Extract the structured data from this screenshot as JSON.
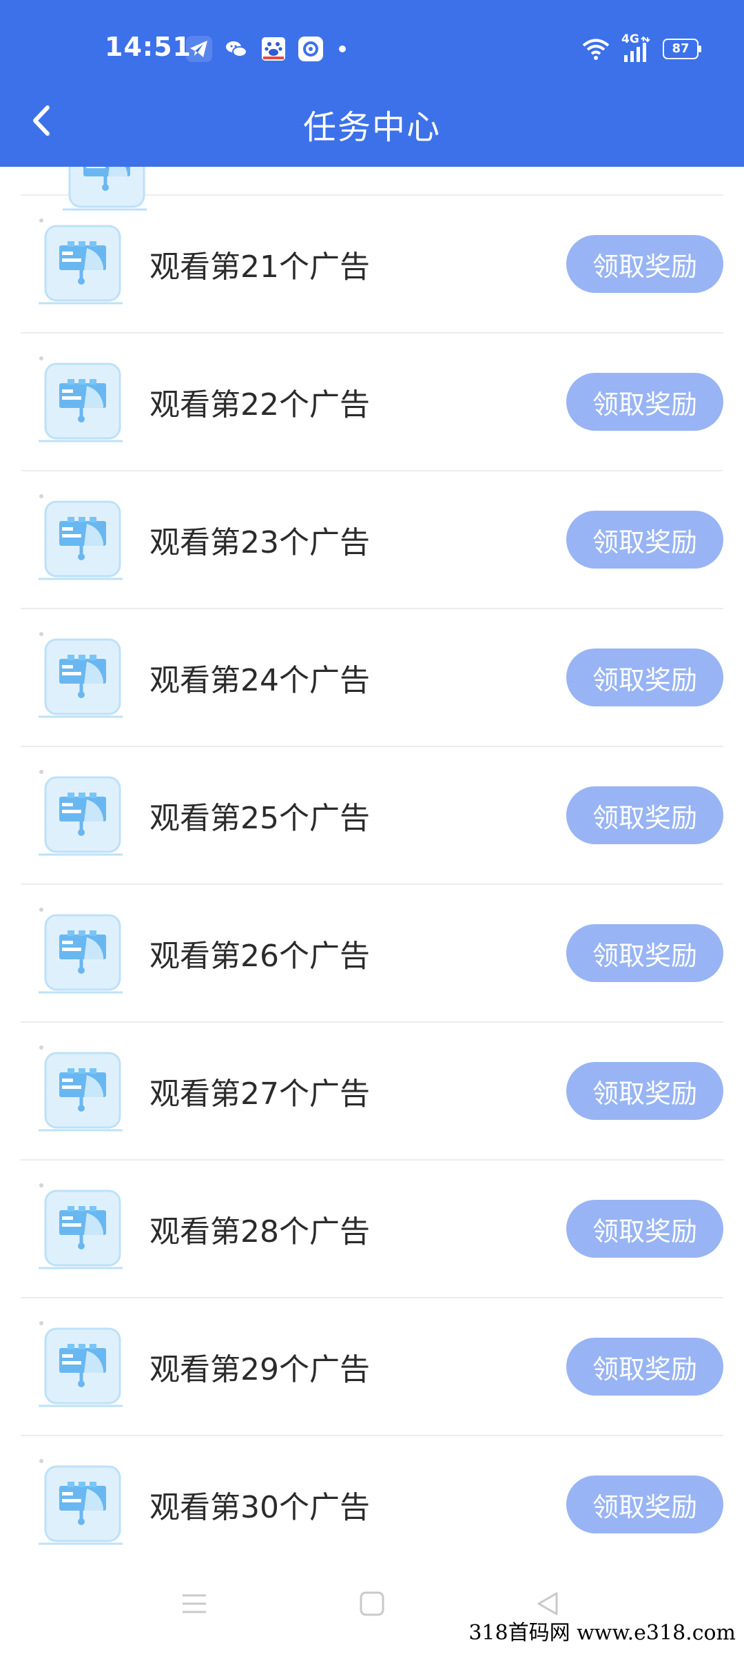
{
  "status_bar": {
    "time": "14:51",
    "network": "4G",
    "battery": "87"
  },
  "header": {
    "title": "任务中心"
  },
  "tasks": [
    {
      "label": "观看第21个广告",
      "button": "领取奖励"
    },
    {
      "label": "观看第22个广告",
      "button": "领取奖励"
    },
    {
      "label": "观看第23个广告",
      "button": "领取奖励"
    },
    {
      "label": "观看第24个广告",
      "button": "领取奖励"
    },
    {
      "label": "观看第25个广告",
      "button": "领取奖励"
    },
    {
      "label": "观看第26个广告",
      "button": "领取奖励"
    },
    {
      "label": "观看第27个广告",
      "button": "领取奖励"
    },
    {
      "label": "观看第28个广告",
      "button": "领取奖励"
    },
    {
      "label": "观看第29个广告",
      "button": "领取奖励"
    },
    {
      "label": "观看第30个广告",
      "button": "领取奖励"
    }
  ],
  "watermark": "318首码网  www.e318.com",
  "icons": {
    "back": "chevron-left-icon",
    "menu": "menu-icon",
    "home": "home-square-icon",
    "back_nav": "triangle-back-icon",
    "task": "ad-task-icon"
  },
  "colors": {
    "header": "#3d71ea",
    "button": "#98b4f4",
    "divider": "#ececec",
    "task_text": "#2b2b2b"
  }
}
